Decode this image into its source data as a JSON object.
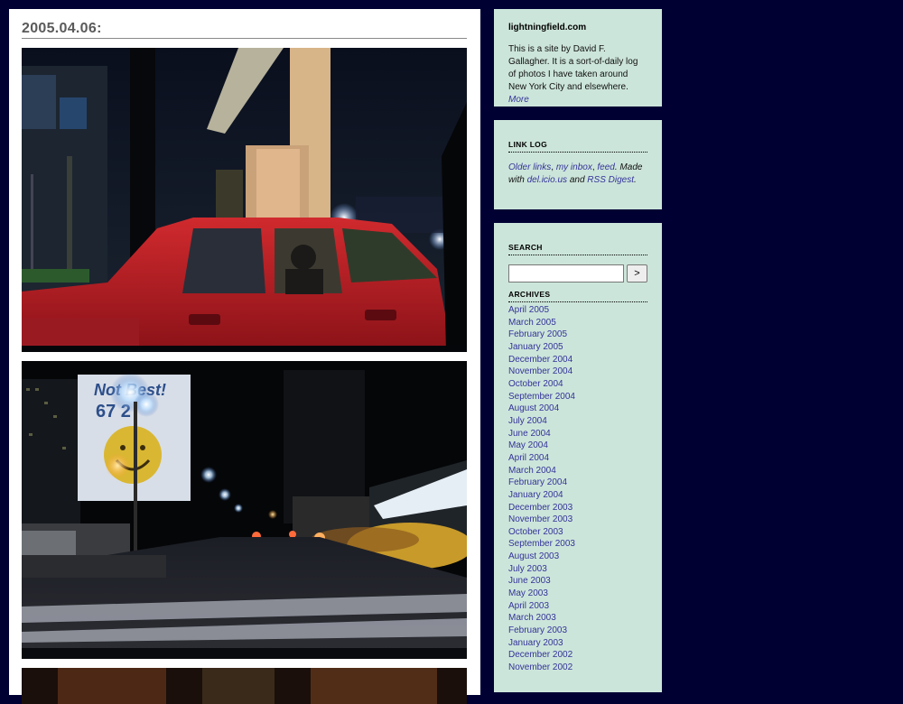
{
  "post": {
    "date": "2005.04.06:"
  },
  "sidebar": {
    "about": {
      "title": "lightningfield.com",
      "text": "This is a site by David F. Gallagher. It is a sort-of-daily log of photos I have taken around New York City and elsewhere.",
      "more_link": "More"
    },
    "link_log": {
      "heading": "LINK LOG",
      "older_links": "Older links",
      "my_inbox": "my inbox",
      "feed": "feed",
      "made_with_text": "Made with",
      "delicious": "del.icio.us",
      "and_text": "and",
      "rss_digest": "RSS Digest"
    },
    "search": {
      "heading": "SEARCH",
      "button_label": ">",
      "input_value": ""
    },
    "archives": {
      "heading": "ARCHIVES",
      "months": [
        "April 2005",
        "March 2005",
        "February 2005",
        "January 2005",
        "December 2004",
        "November 2004",
        "October 2004",
        "September 2004",
        "August 2004",
        "July 2004",
        "June 2004",
        "May 2004",
        "April 2004",
        "March 2004",
        "February 2004",
        "January 2004",
        "December 2003",
        "November 2003",
        "October 2003",
        "September 2003",
        "August 2003",
        "July 2003",
        "June 2003",
        "May 2003",
        "April 2003",
        "March 2003",
        "February 2003",
        "January 2003",
        "December 2002",
        "November 2002"
      ]
    }
  },
  "billboard": {
    "line1": "Not Best!",
    "line2": "67 2"
  },
  "colors": {
    "page_background": "#000033",
    "sidebar_background": "#cce5da",
    "link_color": "#333399",
    "date_color": "#5a5a5a"
  }
}
